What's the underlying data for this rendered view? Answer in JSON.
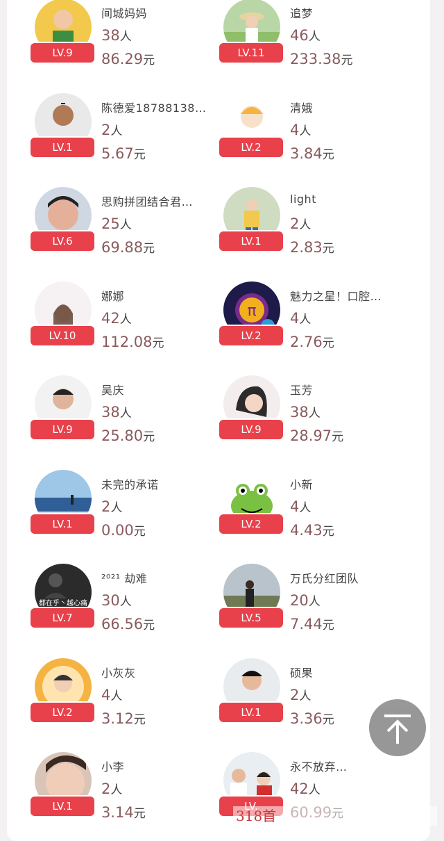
{
  "colors": {
    "badge": "#e8414b",
    "value": "#8a5b5e",
    "text": "#444444",
    "back_top": "#8f8f8f"
  },
  "members": [
    {
      "name": "间城妈妈",
      "count": "38",
      "count_unit": "人",
      "amount": "86.29",
      "amount_unit": "元",
      "level": "LV.9",
      "avatar": "girl-yellow"
    },
    {
      "name": "追梦",
      "count": "46",
      "count_unit": "人",
      "amount": "233.38",
      "amount_unit": "元",
      "level": "LV.11",
      "avatar": "girl-hat"
    },
    {
      "name": "陈德爱18788138…",
      "count": "2",
      "count_unit": "人",
      "amount": "5.67",
      "amount_unit": "元",
      "level": "LV.1",
      "avatar": "man-white"
    },
    {
      "name": "清娥",
      "count": "4",
      "count_unit": "人",
      "amount": "3.84",
      "amount_unit": "元",
      "level": "LV.2",
      "avatar": "default-person"
    },
    {
      "name": "思购拼团结合君…",
      "count": "25",
      "count_unit": "人",
      "amount": "69.88",
      "amount_unit": "元",
      "level": "LV.6",
      "avatar": "man-selfie"
    },
    {
      "name": "light",
      "count": "2",
      "count_unit": "人",
      "amount": "2.83",
      "amount_unit": "元",
      "level": "LV.1",
      "avatar": "kid-yellow"
    },
    {
      "name": "娜娜",
      "count": "42",
      "count_unit": "人",
      "amount": "112.08",
      "amount_unit": "元",
      "level": "LV.10",
      "avatar": "girl-portrait"
    },
    {
      "name": "魅力之星！口腔…",
      "count": "4",
      "count_unit": "人",
      "amount": "2.76",
      "amount_unit": "元",
      "level": "LV.2",
      "avatar": "pi-logo"
    },
    {
      "name": "吴庆",
      "count": "38",
      "count_unit": "人",
      "amount": "25.80",
      "amount_unit": "元",
      "level": "LV.9",
      "avatar": "man-red"
    },
    {
      "name": "玉芳",
      "count": "38",
      "count_unit": "人",
      "amount": "28.97",
      "amount_unit": "元",
      "level": "LV.9",
      "avatar": "woman-smile"
    },
    {
      "name": "未完的承诺",
      "count": "2",
      "count_unit": "人",
      "amount": "0.00",
      "amount_unit": "元",
      "level": "LV.1",
      "avatar": "sea"
    },
    {
      "name": "小新",
      "count": "4",
      "count_unit": "人",
      "amount": "4.43",
      "amount_unit": "元",
      "level": "LV.2",
      "avatar": "frog"
    },
    {
      "name": "²⁰²¹ 劫难",
      "count": "30",
      "count_unit": "人",
      "amount": "66.56",
      "amount_unit": "元",
      "level": "LV.7",
      "avatar": "dark-text"
    },
    {
      "name": "万氏分红团队",
      "count": "20",
      "count_unit": "人",
      "amount": "7.44",
      "amount_unit": "元",
      "level": "LV.5",
      "avatar": "man-field"
    },
    {
      "name": "小灰灰",
      "count": "4",
      "count_unit": "人",
      "amount": "3.12",
      "amount_unit": "元",
      "level": "LV.2",
      "avatar": "boy-orange"
    },
    {
      "name": "硕果",
      "count": "2",
      "count_unit": "人",
      "amount": "3.36",
      "amount_unit": "元",
      "level": "LV.1",
      "avatar": "man-blue"
    },
    {
      "name": "小李",
      "count": "2",
      "count_unit": "人",
      "amount": "3.14",
      "amount_unit": "元",
      "level": "LV.1",
      "avatar": "face-closeup"
    },
    {
      "name": "永不放弃…",
      "count": "42",
      "count_unit": "人",
      "amount": "60.99",
      "amount_unit": "元",
      "level": "LV.",
      "avatar": "couple"
    }
  ],
  "back_to_top": {
    "icon": "arrow-up-bar-icon"
  },
  "watermark": {
    "text": "318首"
  },
  "avatar_text": {
    "dark_text": "都在乎丶越心痛"
  }
}
